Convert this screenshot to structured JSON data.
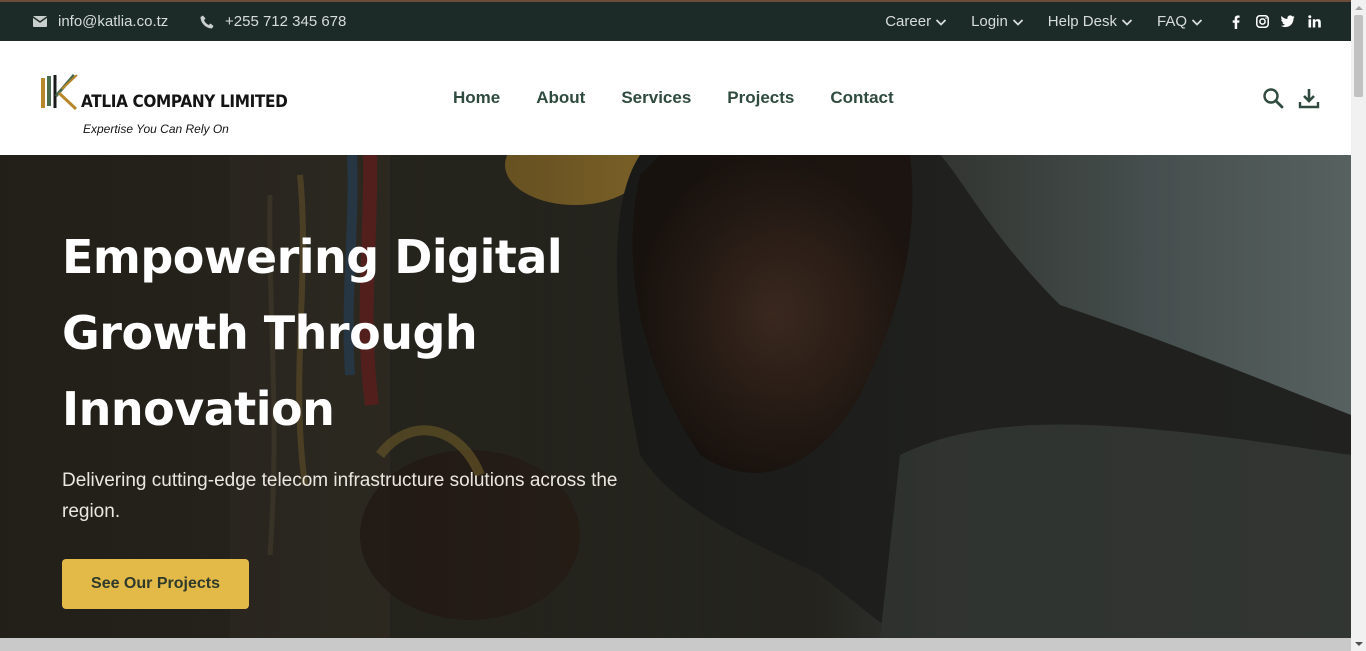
{
  "topbar": {
    "email": "info@katlia.co.tz",
    "phone": "+255 712 345 678",
    "menus": [
      {
        "label": "Career"
      },
      {
        "label": "Login"
      },
      {
        "label": "Help Desk"
      },
      {
        "label": "FAQ"
      }
    ],
    "social_icons": [
      "facebook-icon",
      "instagram-icon",
      "twitter-icon",
      "linkedin-icon"
    ],
    "background": "#1d2b28"
  },
  "header": {
    "logo": {
      "name": "ATLIA COMPANY LIMITED",
      "tagline": "Expertise You Can Rely On",
      "mark_colors": [
        "#b8862b",
        "#4a6a4e",
        "#1a1a1a"
      ]
    },
    "nav": [
      {
        "label": "Home"
      },
      {
        "label": "About"
      },
      {
        "label": "Services"
      },
      {
        "label": "Projects"
      },
      {
        "label": "Contact"
      }
    ],
    "tools": [
      "search-icon",
      "download-icon"
    ],
    "nav_color": "#2f4a3e"
  },
  "hero": {
    "title": "Empowering Digital Growth Through Innovation",
    "subtitle": "Delivering cutting-edge telecom infrastructure solutions across the region.",
    "cta_label": "See Our Projects",
    "cta_color": "#e3b947"
  }
}
